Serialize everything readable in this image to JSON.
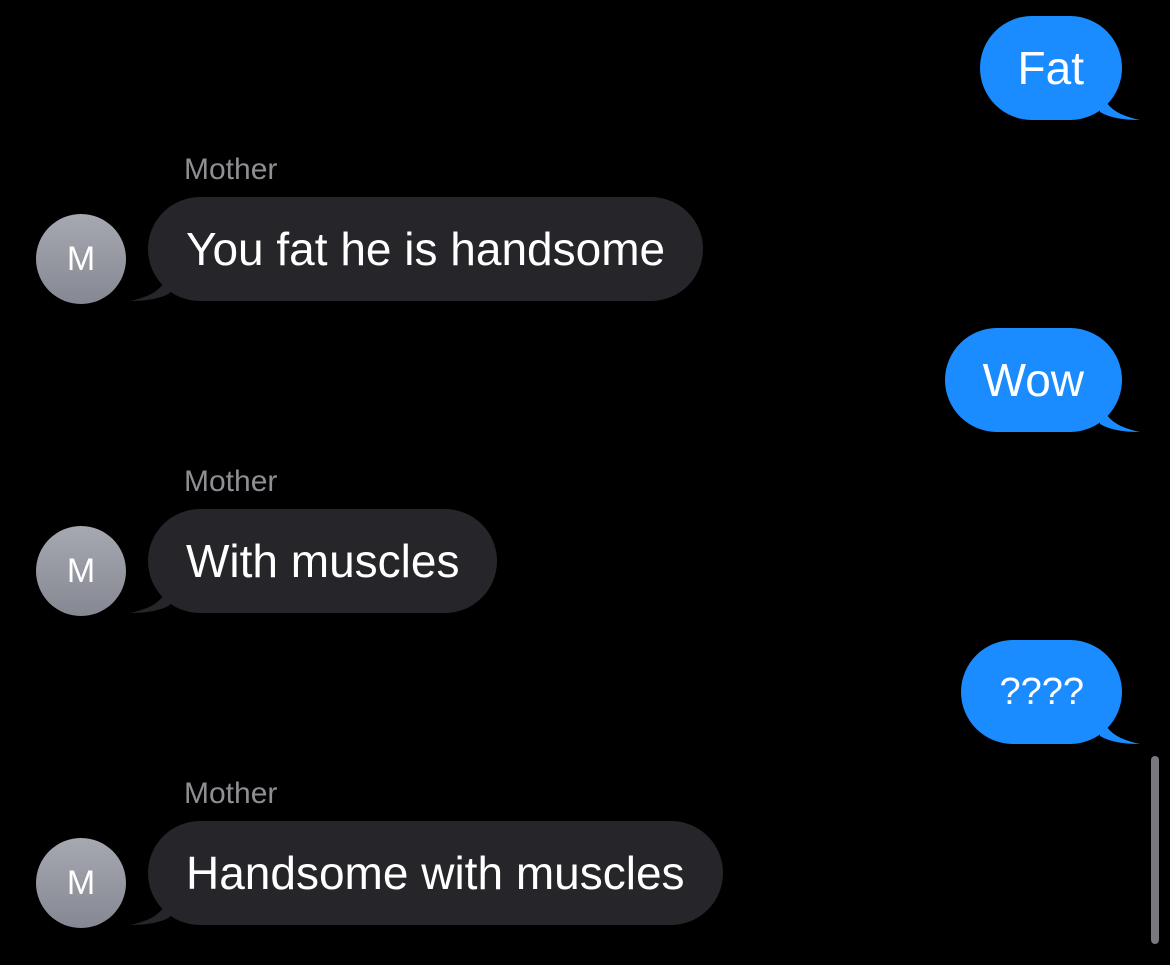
{
  "conversation": {
    "contact_name": "Mother",
    "contact_initial": "M",
    "colors": {
      "background": "#000000",
      "outgoing_bubble": "#1b8cff",
      "incoming_bubble": "#26262a",
      "sender_label": "#8e8e93"
    },
    "messages": [
      {
        "direction": "outgoing",
        "text": "Fat"
      },
      {
        "direction": "incoming",
        "sender": "Mother",
        "text": "You fat he is handsome"
      },
      {
        "direction": "outgoing",
        "text": "Wow"
      },
      {
        "direction": "incoming",
        "sender": "Mother",
        "text": "With muscles"
      },
      {
        "direction": "outgoing",
        "text": "????"
      },
      {
        "direction": "incoming",
        "sender": "Mother",
        "text": "Handsome with muscles"
      }
    ]
  }
}
